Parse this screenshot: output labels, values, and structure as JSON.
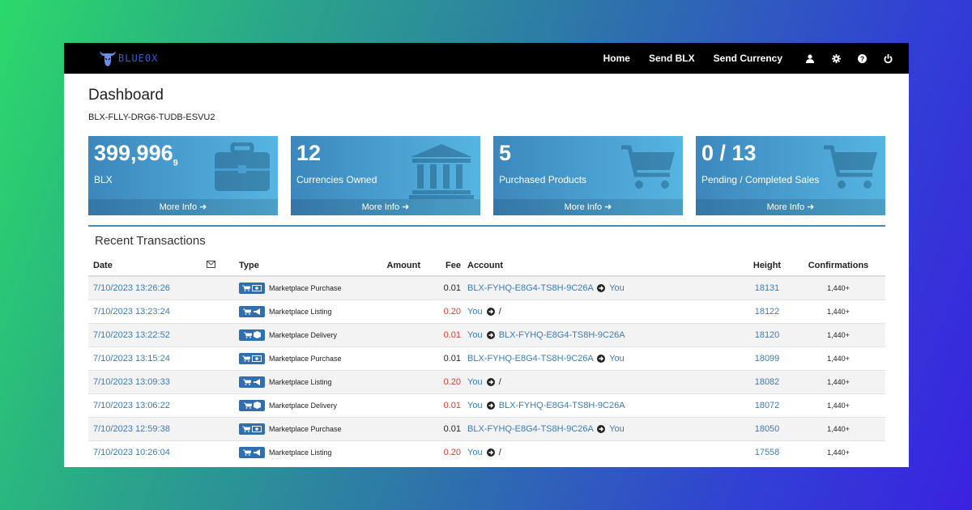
{
  "brand": {
    "name": "BLUE0X"
  },
  "nav": {
    "items": [
      "Home",
      "Send BLX",
      "Send Currency"
    ],
    "icons": [
      "user-icon",
      "gear-icon",
      "help-icon",
      "power-icon"
    ]
  },
  "page": {
    "title": "Dashboard",
    "account_id": "BLX-FLLY-DRG6-TUDB-ESVU2"
  },
  "cards": [
    {
      "value": "399,996",
      "sub": "9",
      "label": "BLX",
      "icon": "briefcase-icon",
      "more": "More Info"
    },
    {
      "value": "12",
      "sub": "",
      "label": "Currencies Owned",
      "icon": "bank-icon",
      "more": "More Info"
    },
    {
      "value": "5",
      "sub": "",
      "label": "Purchased Products",
      "icon": "cart-icon",
      "more": "More Info"
    },
    {
      "value": "0 / 13",
      "sub": "",
      "label": "Pending / Completed Sales",
      "icon": "cart-icon",
      "more": "More Info"
    }
  ],
  "transactions": {
    "title": "Recent Transactions",
    "columns": {
      "date": "Date",
      "type": "Type",
      "amount": "Amount",
      "fee": "Fee",
      "account": "Account",
      "height": "Height",
      "confirmations": "Confirmations"
    },
    "rows": [
      {
        "date": "7/10/2023 13:26:26",
        "type": "Marketplace Purchase",
        "kind": "purchase",
        "amount": "",
        "fee": "0.01",
        "fee_red": false,
        "from": "BLX-FYHQ-E8G4-TS8H-9C26A",
        "to": "You",
        "height": "18131",
        "confirmations": "1,440+"
      },
      {
        "date": "7/10/2023 13:23:24",
        "type": "Marketplace Listing",
        "kind": "listing",
        "amount": "",
        "fee": "0.20",
        "fee_red": true,
        "from": "You",
        "to": "/",
        "height": "18122",
        "confirmations": "1,440+"
      },
      {
        "date": "7/10/2023 13:22:52",
        "type": "Marketplace Delivery",
        "kind": "delivery",
        "amount": "",
        "fee": "0.01",
        "fee_red": true,
        "from": "You",
        "to": "BLX-FYHQ-E8G4-TS8H-9C26A",
        "height": "18120",
        "confirmations": "1,440+"
      },
      {
        "date": "7/10/2023 13:15:24",
        "type": "Marketplace Purchase",
        "kind": "purchase",
        "amount": "",
        "fee": "0.01",
        "fee_red": false,
        "from": "BLX-FYHQ-E8G4-TS8H-9C26A",
        "to": "You",
        "height": "18099",
        "confirmations": "1,440+"
      },
      {
        "date": "7/10/2023 13:09:33",
        "type": "Marketplace Listing",
        "kind": "listing",
        "amount": "",
        "fee": "0.20",
        "fee_red": true,
        "from": "You",
        "to": "/",
        "height": "18082",
        "confirmations": "1,440+"
      },
      {
        "date": "7/10/2023 13:06:22",
        "type": "Marketplace Delivery",
        "kind": "delivery",
        "amount": "",
        "fee": "0.01",
        "fee_red": true,
        "from": "You",
        "to": "BLX-FYHQ-E8G4-TS8H-9C26A",
        "height": "18072",
        "confirmations": "1,440+"
      },
      {
        "date": "7/10/2023 12:59:38",
        "type": "Marketplace Purchase",
        "kind": "purchase",
        "amount": "",
        "fee": "0.01",
        "fee_red": false,
        "from": "BLX-FYHQ-E8G4-TS8H-9C26A",
        "to": "You",
        "height": "18050",
        "confirmations": "1,440+"
      },
      {
        "date": "7/10/2023 10:26:04",
        "type": "Marketplace Listing",
        "kind": "listing",
        "amount": "",
        "fee": "0.20",
        "fee_red": true,
        "from": "You",
        "to": "/",
        "height": "17558",
        "confirmations": "1,440+"
      }
    ]
  },
  "colors": {
    "accent": "#3c8dbc",
    "link": "#3c7cb4",
    "fee_red": "#e03a2f",
    "topbar": "#000000"
  }
}
